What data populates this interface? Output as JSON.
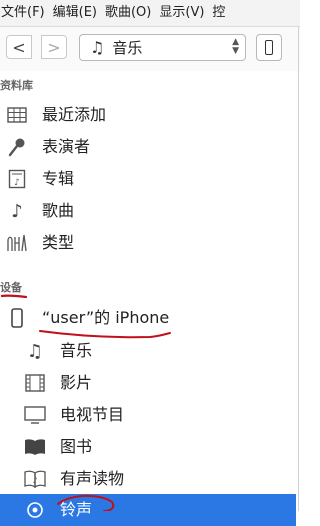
{
  "menubar": [
    "文件(F)",
    "编辑(E)",
    "歌曲(O)",
    "显示(V)",
    "控"
  ],
  "toolbar": {
    "back_glyph": "<",
    "forward_glyph": ">",
    "media_kind": "音乐"
  },
  "library": {
    "title": "资料库",
    "items": [
      {
        "label": "最近添加",
        "icon": "grid-icon"
      },
      {
        "label": "表演者",
        "icon": "microphone-icon"
      },
      {
        "label": "专辑",
        "icon": "album-icon"
      },
      {
        "label": "歌曲",
        "icon": "music-note-icon"
      },
      {
        "label": "类型",
        "icon": "genre-icon"
      }
    ]
  },
  "devices": {
    "title": "设备",
    "device_name": "“user”的 iPhone",
    "items": [
      {
        "label": "音乐",
        "icon": "music-notes-icon"
      },
      {
        "label": "影片",
        "icon": "film-icon"
      },
      {
        "label": "电视节目",
        "icon": "tv-icon"
      },
      {
        "label": "图书",
        "icon": "book-icon"
      },
      {
        "label": "有声读物",
        "icon": "audiobook-icon"
      },
      {
        "label": "铃声",
        "icon": "bell-icon",
        "selected": true
      }
    ]
  },
  "colors": {
    "selection": "#2b78e4",
    "annotation": "#c0101a"
  }
}
